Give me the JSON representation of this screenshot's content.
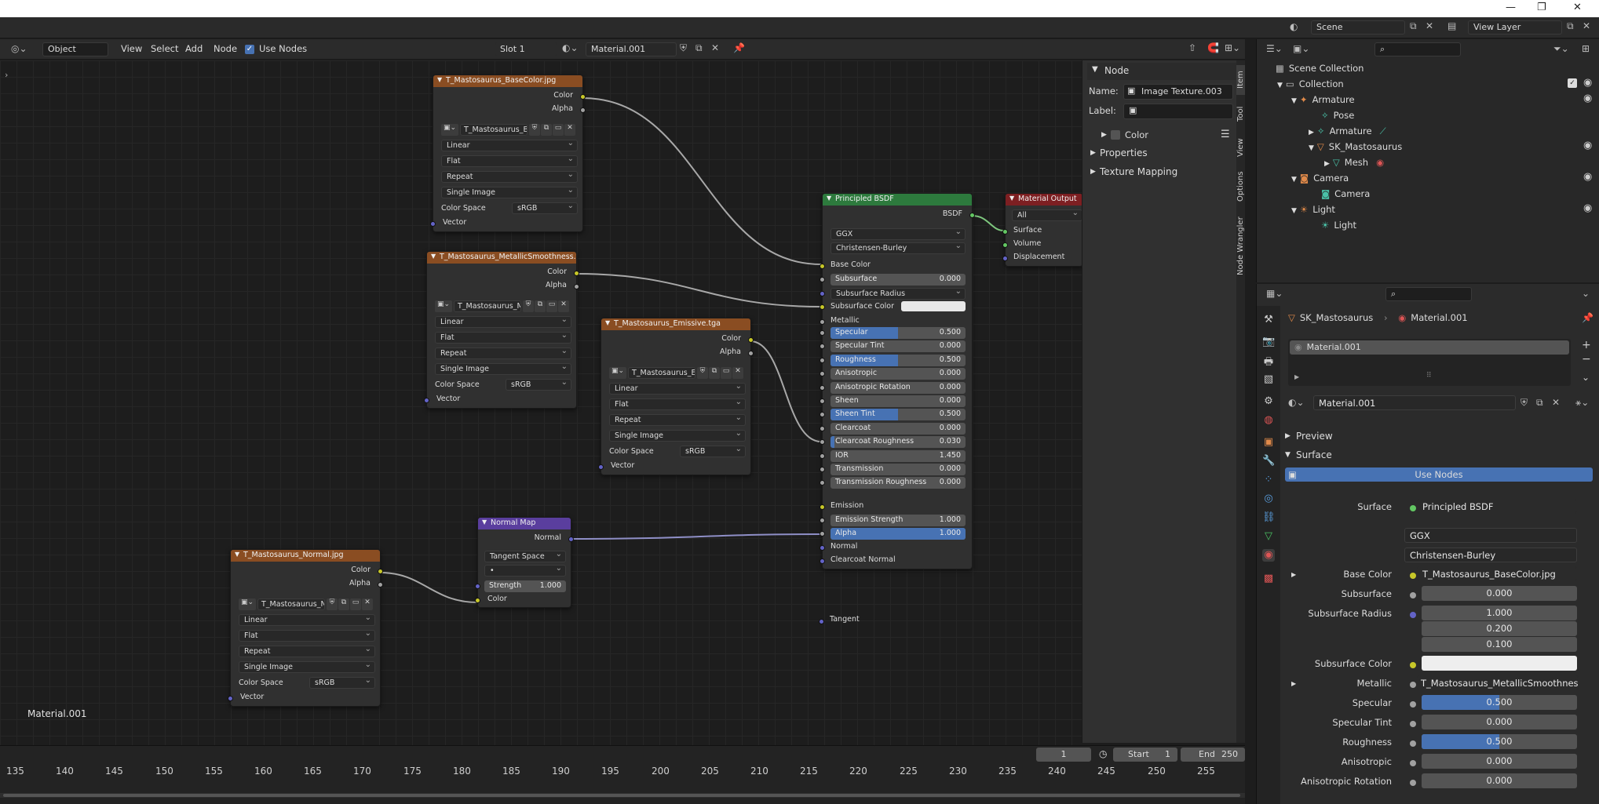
{
  "titlebar": {
    "min": "—",
    "max": "❐",
    "close": "✕"
  },
  "topbar": {
    "scene": "Scene",
    "view_layer": "View Layer"
  },
  "header": {
    "mode": "Object",
    "menus": [
      "View",
      "Select",
      "Add",
      "Node"
    ],
    "use_nodes": "Use Nodes",
    "slot": "Slot 1",
    "material": "Material.001"
  },
  "canvas_label": "Material.001",
  "nodes": {
    "basecolor": {
      "title": "T_Mastosaurus_BaseColor.jpg",
      "color": "Color",
      "alpha": "Alpha",
      "image": "T_Mastosaurus_B...",
      "interp": "Linear",
      "proj": "Flat",
      "ext": "Repeat",
      "src": "Single Image",
      "cs_label": "Color Space",
      "cs": "sRGB",
      "vector": "Vector"
    },
    "metallic": {
      "title": "T_Mastosaurus_MetallicSmoothness.tga",
      "color": "Color",
      "alpha": "Alpha",
      "image": "T_Mastosaurus_M...",
      "interp": "Linear",
      "proj": "Flat",
      "ext": "Repeat",
      "src": "Single Image",
      "cs_label": "Color Space",
      "cs": "sRGB",
      "vector": "Vector"
    },
    "emissive": {
      "title": "T_Mastosaurus_Emissive.tga",
      "color": "Color",
      "alpha": "Alpha",
      "image": "T_Mastosaurus_E...",
      "interp": "Linear",
      "proj": "Flat",
      "ext": "Repeat",
      "src": "Single Image",
      "cs_label": "Color Space",
      "cs": "sRGB",
      "vector": "Vector"
    },
    "normaltex": {
      "title": "T_Mastosaurus_Normal.jpg",
      "color": "Color",
      "alpha": "Alpha",
      "image": "T_Mastosaurus_N...",
      "interp": "Linear",
      "proj": "Flat",
      "ext": "Repeat",
      "src": "Single Image",
      "cs_label": "Color Space",
      "cs": "sRGB",
      "vector": "Vector"
    },
    "normalmap": {
      "title": "Normal Map",
      "normal": "Normal",
      "space": "Tangent Space",
      "uv": "•",
      "strength_label": "Strength",
      "strength": "1.000",
      "color": "Color"
    },
    "bsdf": {
      "title": "Principled BSDF",
      "out": "BSDF",
      "dist": "GGX",
      "sss_method": "Christensen-Burley",
      "base_color": "Base Color",
      "subsurface": "Subsurface",
      "subsurface_val": "0.000",
      "subsurface_radius": "Subsurface Radius",
      "subsurface_color": "Subsurface Color",
      "metallic": "Metallic",
      "sliders": [
        {
          "label": "Specular",
          "value": "0.500",
          "fill": 0.5
        },
        {
          "label": "Specular Tint",
          "value": "0.000",
          "fill": 0
        },
        {
          "label": "Roughness",
          "value": "0.500",
          "fill": 0.5
        },
        {
          "label": "Anisotropic",
          "value": "0.000",
          "fill": 0
        },
        {
          "label": "Anisotropic Rotation",
          "value": "0.000",
          "fill": 0
        },
        {
          "label": "Sheen",
          "value": "0.000",
          "fill": 0
        },
        {
          "label": "Sheen Tint",
          "value": "0.500",
          "fill": 0.5
        },
        {
          "label": "Clearcoat",
          "value": "0.000",
          "fill": 0
        },
        {
          "label": "Clearcoat Roughness",
          "value": "0.030",
          "fill": 0.03
        },
        {
          "label": "IOR",
          "value": "1.450",
          "fill": 0
        },
        {
          "label": "Transmission",
          "value": "0.000",
          "fill": 0
        },
        {
          "label": "Transmission Roughness",
          "value": "0.000",
          "fill": 0
        }
      ],
      "emission": "Emission",
      "emission_strength": "Emission Strength",
      "emission_strength_val": "1.000",
      "alpha": "Alpha",
      "alpha_val": "1.000",
      "normal": "Normal",
      "clearcoat_normal": "Clearcoat Normal",
      "tangent": "Tangent"
    },
    "output": {
      "title": "Material Output",
      "target": "All",
      "surface": "Surface",
      "volume": "Volume",
      "displacement": "Displacement"
    }
  },
  "sidebar": {
    "section": "Node",
    "name_label": "Name:",
    "name": "Image Texture.003",
    "label_label": "Label:",
    "color": "Color",
    "properties": "Properties",
    "texture_mapping": "Texture Mapping",
    "tabs": [
      "Item",
      "Tool",
      "View",
      "Options",
      "Node Wrangler"
    ]
  },
  "timeline": {
    "ticks": [
      "135",
      "140",
      "145",
      "150",
      "155",
      "160",
      "165",
      "170",
      "175",
      "180",
      "185",
      "190",
      "195",
      "200",
      "205",
      "210",
      "215",
      "220",
      "225",
      "230",
      "235",
      "240",
      "245",
      "250",
      "255"
    ],
    "frame": "1",
    "start_label": "Start",
    "start": "1",
    "end_label": "End",
    "end": "250"
  },
  "outliner": {
    "items": [
      "Scene Collection",
      "Collection",
      "Armature",
      "Pose",
      "Armature",
      "SK_Mastosaurus",
      "Mesh",
      "Camera",
      "Camera",
      "Light",
      "Light"
    ]
  },
  "props": {
    "object": "SK_Mastosaurus",
    "material": "Material.001",
    "slot": "Material.001",
    "mat_field": "Material.001",
    "preview": "Preview",
    "surface_section": "Surface",
    "use_nodes": "Use Nodes",
    "rows": {
      "surface_label": "Surface",
      "surface": "Principled BSDF",
      "dist": "GGX",
      "sss": "Christensen-Burley",
      "base_color_label": "Base Color",
      "base_color": "T_Mastosaurus_BaseColor.jpg",
      "subsurface_label": "Subsurface",
      "subsurface": "0.000",
      "sss_radius_label": "Subsurface Radius",
      "r1": "1.000",
      "r2": "0.200",
      "r3": "0.100",
      "sss_color_label": "Subsurface Color",
      "metallic_label": "Metallic",
      "metallic": "T_Mastosaurus_MetallicSmoothness.tga",
      "specular_label": "Specular",
      "specular": "0.500",
      "spec_tint_label": "Specular Tint",
      "spec_tint": "0.000",
      "roughness_label": "Roughness",
      "roughness": "0.500",
      "aniso_label": "Anisotropic",
      "aniso": "0.000",
      "aniso_rot_label": "Anisotropic Rotation",
      "aniso_rot": "0.000"
    }
  },
  "colors": {
    "accent": "#4772b3",
    "texture_header": "#8a4d22",
    "shader_header": "#2d7a3d",
    "output_header": "#7d1f22",
    "vector_header": "#5a3e9e",
    "socket_color": "#c7c729",
    "socket_float": "#a1a1a1",
    "socket_vector": "#6363c7"
  }
}
